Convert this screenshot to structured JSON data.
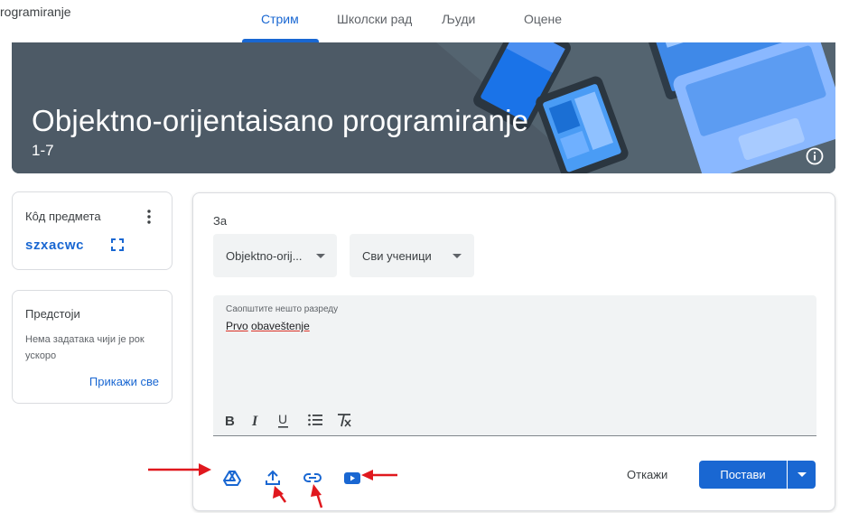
{
  "header": {
    "app_title": "rogramiranje",
    "tabs": [
      {
        "label": "Стрим",
        "active": true
      },
      {
        "label": "Школски рад",
        "active": false
      },
      {
        "label": "Људи",
        "active": false
      },
      {
        "label": "Оцене",
        "active": false
      }
    ]
  },
  "banner": {
    "title": "Objektno-orijentaisano programiranje",
    "section": "1-7",
    "info_icon": "info-icon"
  },
  "class_code_card": {
    "label": "Кôд предмета",
    "code": "szxacwc",
    "more_icon": "more-vert-icon",
    "fullscreen_icon": "fullscreen-icon"
  },
  "upcoming_card": {
    "title": "Предстоји",
    "text": "Нема задатака чији је рок ускоро",
    "view_all": "Прикажи све"
  },
  "composer": {
    "for_label": "За",
    "class_select": "Objektno-orij...",
    "students_select": "Сви ученици",
    "editor_placeholder": "Саопштите нешто разреду",
    "editor_words": [
      "Prvo",
      "obaveštenje"
    ],
    "format_icons": [
      "bold-icon",
      "italic-icon",
      "underline-icon",
      "bulleted-list-icon",
      "clear-formatting-icon"
    ],
    "attach_icons": [
      "google-drive-icon",
      "upload-icon",
      "link-icon",
      "youtube-icon"
    ],
    "cancel_label": "Откажи",
    "post_label": "Постави"
  },
  "colors": {
    "accent": "#1967d2",
    "banner_bg": "#4d5a66",
    "annotation_arrow": "#e0181e"
  }
}
